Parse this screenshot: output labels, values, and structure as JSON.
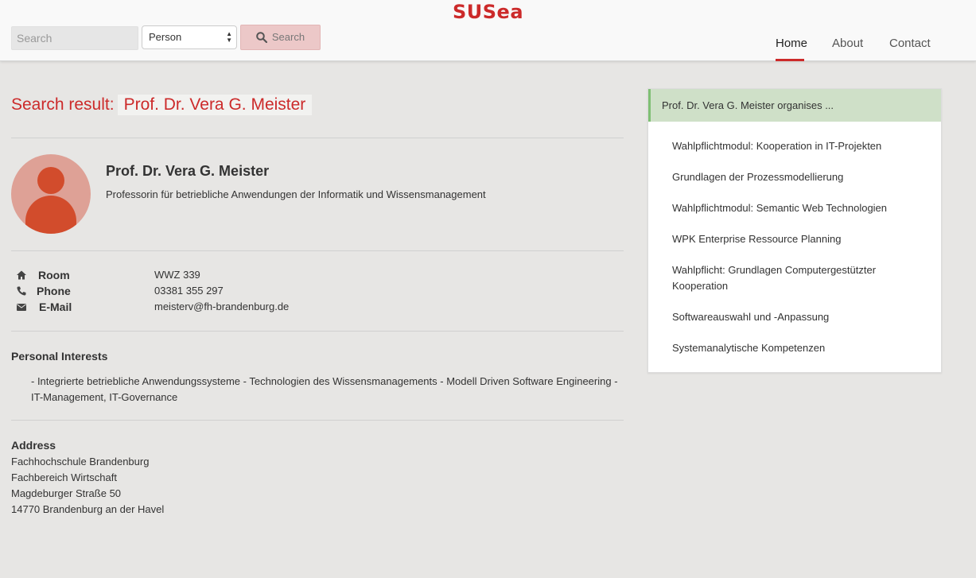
{
  "header": {
    "brand": "SUSea",
    "search_placeholder": "Search",
    "type_select_value": "Person",
    "search_button": "Search",
    "nav": [
      "Home",
      "About",
      "Contact"
    ],
    "active_nav": "Home"
  },
  "result": {
    "heading": "Search result:",
    "query_name": "Prof. Dr. Vera G. Meister"
  },
  "person": {
    "name": "Prof. Dr. Vera G. Meister",
    "title": "Professorin für betriebliche Anwendungen der Informatik und Wissensmanagement",
    "contact": [
      {
        "icon": "home-icon",
        "label": "Room",
        "value": "WWZ 339"
      },
      {
        "icon": "phone-icon",
        "label": "Phone",
        "value": "03381 355 297"
      },
      {
        "icon": "envelope-icon",
        "label": "E-Mail",
        "value": "meisterv@fh-brandenburg.de"
      }
    ]
  },
  "interests": {
    "title": "Personal Interests",
    "text": "- Integrierte betriebliche Anwendungssysteme - Technologien des Wissensmanagements - Modell Driven Software Engineering - IT-Management, IT-Governance"
  },
  "address": {
    "title": "Address",
    "lines": [
      "Fachhochschule Brandenburg",
      "Fachbereich Wirtschaft",
      "Magdeburger Straße 50",
      "14770 Brandenburg an der Havel"
    ]
  },
  "organises": {
    "title": "Prof. Dr. Vera G. Meister organises ...",
    "items": [
      "Wahlpflichtmodul: Kooperation in IT-Projekten",
      "Grundlagen der Prozessmodellierung",
      "Wahlpflichtmodul: Semantic Web Technologien",
      "WPK Enterprise Ressource Planning",
      "Wahlpflicht: Grundlagen Computergestützter Kooperation",
      "Softwareauswahl und -Anpassung",
      "Systemanalytische Kompetenzen"
    ]
  },
  "colors": {
    "brand": "#cc2a2a",
    "panel_head": "#cfe0c8",
    "panel_accent": "#7fbf73",
    "avatar_bg": "#dea196"
  }
}
